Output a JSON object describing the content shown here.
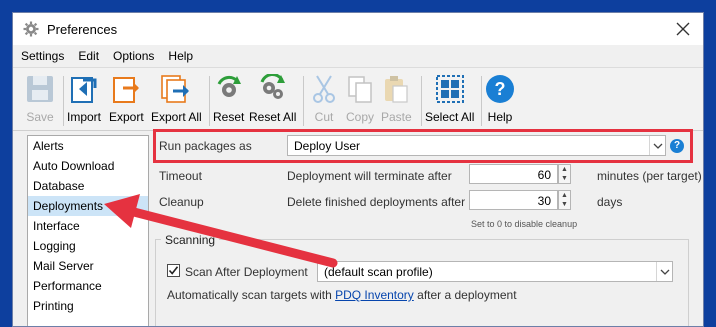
{
  "window": {
    "title": "Preferences"
  },
  "menu": [
    "Settings",
    "Edit",
    "Options",
    "Help"
  ],
  "toolbar": [
    {
      "label": "Save",
      "icon": "save-icon",
      "disabled": true
    },
    {
      "label": "Import",
      "icon": "import-icon",
      "disabled": false
    },
    {
      "label": "Export",
      "icon": "export-icon",
      "disabled": false
    },
    {
      "label": "Export All",
      "icon": "export-all-icon",
      "disabled": false
    },
    {
      "label": "Reset",
      "icon": "reset-icon",
      "disabled": false
    },
    {
      "label": "Reset All",
      "icon": "reset-all-icon",
      "disabled": false
    },
    {
      "label": "Cut",
      "icon": "cut-icon",
      "disabled": true
    },
    {
      "label": "Copy",
      "icon": "copy-icon",
      "disabled": true
    },
    {
      "label": "Paste",
      "icon": "paste-icon",
      "disabled": true
    },
    {
      "label": "Select All",
      "icon": "select-all-icon",
      "disabled": false
    },
    {
      "label": "Help",
      "icon": "help-icon",
      "disabled": false
    }
  ],
  "sidebar": {
    "items": [
      "Alerts",
      "Auto Download",
      "Database",
      "Deployments",
      "Interface",
      "Logging",
      "Mail Server",
      "Performance",
      "Printing"
    ],
    "selected": "Deployments"
  },
  "form": {
    "run_as_label": "Run packages as",
    "run_as_value": "Deploy User",
    "timeout_label": "Timeout",
    "timeout_text": "Deployment will terminate after",
    "timeout_value": "60",
    "timeout_unit": "minutes (per target)",
    "cleanup_label": "Cleanup",
    "cleanup_text": "Delete finished deployments after",
    "cleanup_value": "30",
    "cleanup_unit": "days",
    "cleanup_hint": "Set to 0 to disable cleanup"
  },
  "scanning": {
    "group_title": "Scanning",
    "checkbox_label": "Scan After Deployment",
    "checked": true,
    "profile_value": "(default scan profile)",
    "desc_prefix": "Automatically scan targets with",
    "desc_link": "PDQ Inventory",
    "desc_suffix": "after a deployment"
  },
  "colors": {
    "highlight": "#e53240",
    "border_blue": "#0d3f9e",
    "accent": "#1a7fd4"
  }
}
